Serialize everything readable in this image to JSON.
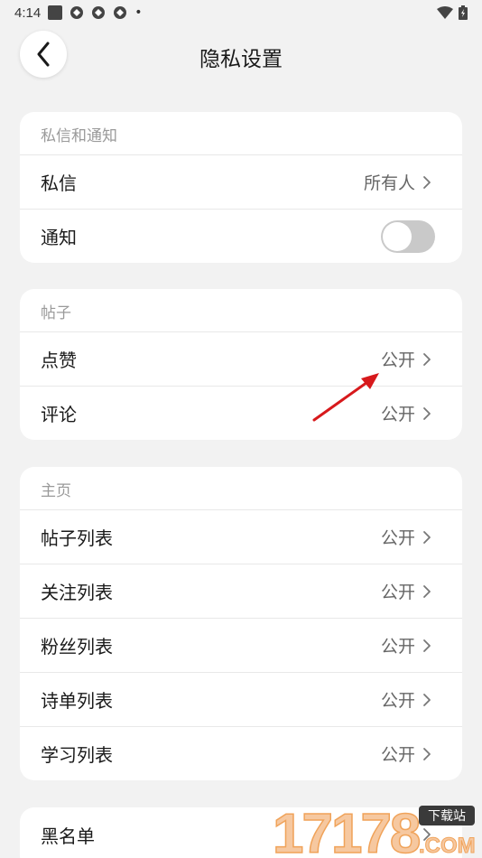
{
  "status_bar": {
    "time": "4:14"
  },
  "header": {
    "title": "隐私设置"
  },
  "sections": {
    "messages": {
      "title": "私信和通知",
      "dm_label": "私信",
      "dm_value": "所有人",
      "notify_label": "通知",
      "notify_on": false
    },
    "posts": {
      "title": "帖子",
      "like_label": "点赞",
      "like_value": "公开",
      "comment_label": "评论",
      "comment_value": "公开"
    },
    "home": {
      "title": "主页",
      "items": [
        {
          "label": "帖子列表",
          "value": "公开"
        },
        {
          "label": "关注列表",
          "value": "公开"
        },
        {
          "label": "粉丝列表",
          "value": "公开"
        },
        {
          "label": "诗单列表",
          "value": "公开"
        },
        {
          "label": "学习列表",
          "value": "公开"
        }
      ]
    },
    "blacklist": {
      "label": "黑名单"
    }
  },
  "watermark": {
    "number": "17178",
    "badge": "下载站",
    "domain": ".COM"
  },
  "colors": {
    "background": "#f2f2f2",
    "card": "#ffffff",
    "annotation_arrow": "#d7191c",
    "watermark": "#f0a35a"
  }
}
